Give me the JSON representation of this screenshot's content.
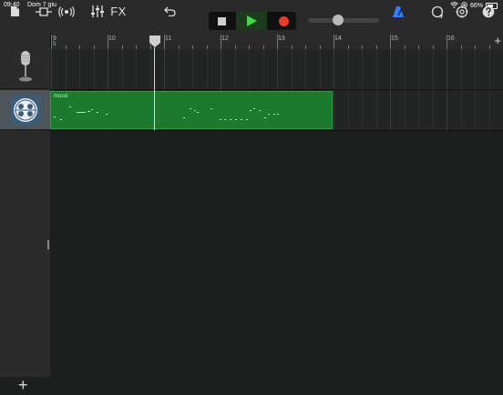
{
  "status_bar": {
    "time": "09:40",
    "date": "Dom 7 giu",
    "battery": "66%",
    "icons": [
      "wifi-icon",
      "orientation-lock-icon",
      "battery-icon"
    ]
  },
  "toolbar": {
    "items": [
      "my-songs-icon",
      "browser-icon",
      "smart-controls-icon",
      "mixer-icon",
      "fx-label",
      "undo-icon",
      "stop-icon",
      "play-icon",
      "record-icon",
      "master-volume-slider",
      "metronome-icon",
      "loop-icon",
      "tempo-settings-icon",
      "help-icon"
    ],
    "fx_label": "FX",
    "master_volume": 0.42
  },
  "ruler": {
    "bar_numbers": [
      "9",
      "10",
      "11",
      "12",
      "13",
      "14",
      "15",
      "16"
    ],
    "sub_label": "5",
    "add_section_label": "+"
  },
  "tracks": [
    {
      "name": "Audio Recorder",
      "icon": "microphone-icon",
      "selected": false
    },
    {
      "name": "Drums",
      "icon": "drum-pad-icon",
      "selected": true
    }
  ],
  "region": {
    "name": "mood",
    "color": "#1c7a2c"
  },
  "add_track_label": "+"
}
